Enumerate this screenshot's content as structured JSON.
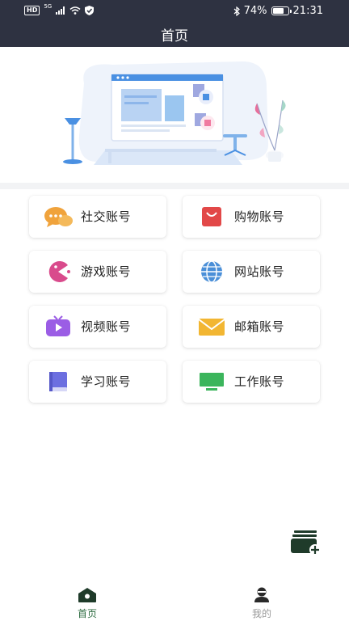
{
  "status_bar": {
    "hd": "HD",
    "network": "5G",
    "battery_percent": "74%",
    "battery_level": 0.74,
    "time": "21:31"
  },
  "header": {
    "title": "首页"
  },
  "colors": {
    "header_bg": "#2e3241",
    "tab_active": "#2c6b3f",
    "tab_inactive": "#999999"
  },
  "categories": [
    {
      "label": "社交账号",
      "icon": "chat-bubbles-icon"
    },
    {
      "label": "购物账号",
      "icon": "shopping-bag-icon"
    },
    {
      "label": "游戏账号",
      "icon": "pacman-icon"
    },
    {
      "label": "网站账号",
      "icon": "globe-icon"
    },
    {
      "label": "视频账号",
      "icon": "tv-play-icon"
    },
    {
      "label": "邮箱账号",
      "icon": "envelope-icon"
    },
    {
      "label": "学习账号",
      "icon": "book-icon"
    },
    {
      "label": "工作账号",
      "icon": "monitor-icon"
    }
  ],
  "fab": {
    "icon": "add-cards-icon"
  },
  "tabs": [
    {
      "label": "首页",
      "icon": "home-icon",
      "active": true
    },
    {
      "label": "我的",
      "icon": "user-icon",
      "active": false
    }
  ]
}
